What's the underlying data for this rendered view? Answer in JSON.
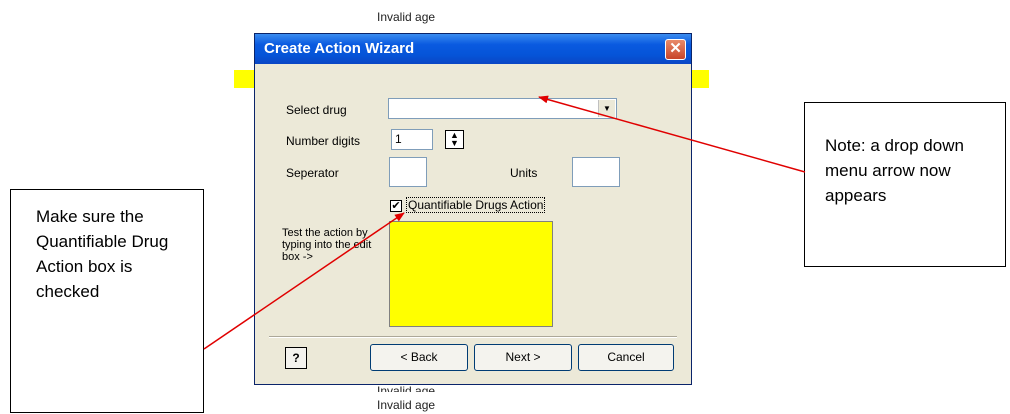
{
  "background": {
    "top_text": "Invalid age",
    "bottom_text_1": "Invalid age",
    "bottom_text_2": "Invalid age"
  },
  "dialog": {
    "title": "Create Action Wizard",
    "close_glyph": "✕",
    "select_drug_label": "Select drug",
    "select_drug_value": "",
    "number_digits_label": "Number digits",
    "number_digits_value": "1",
    "separator_label": "Seperator",
    "separator_value": "",
    "units_label": "Units",
    "units_value": "",
    "quantifiable_label": "Quantifiable Drugs Action",
    "quantifiable_checked": true,
    "check_glyph": "✔",
    "test_label": "Test the action by typing into the edit box  ->",
    "help_glyph": "?",
    "back_label": "< Back",
    "next_label": "Next >",
    "cancel_label": "Cancel"
  },
  "annotations": {
    "left_note": "Make sure the Quantifiable Drug Action box is checked",
    "right_note": "Note: a drop down menu arrow now appears"
  },
  "colors": {
    "highlight": "#ffff00",
    "arrow": "#e00000",
    "titlebar": "#0554d8"
  }
}
